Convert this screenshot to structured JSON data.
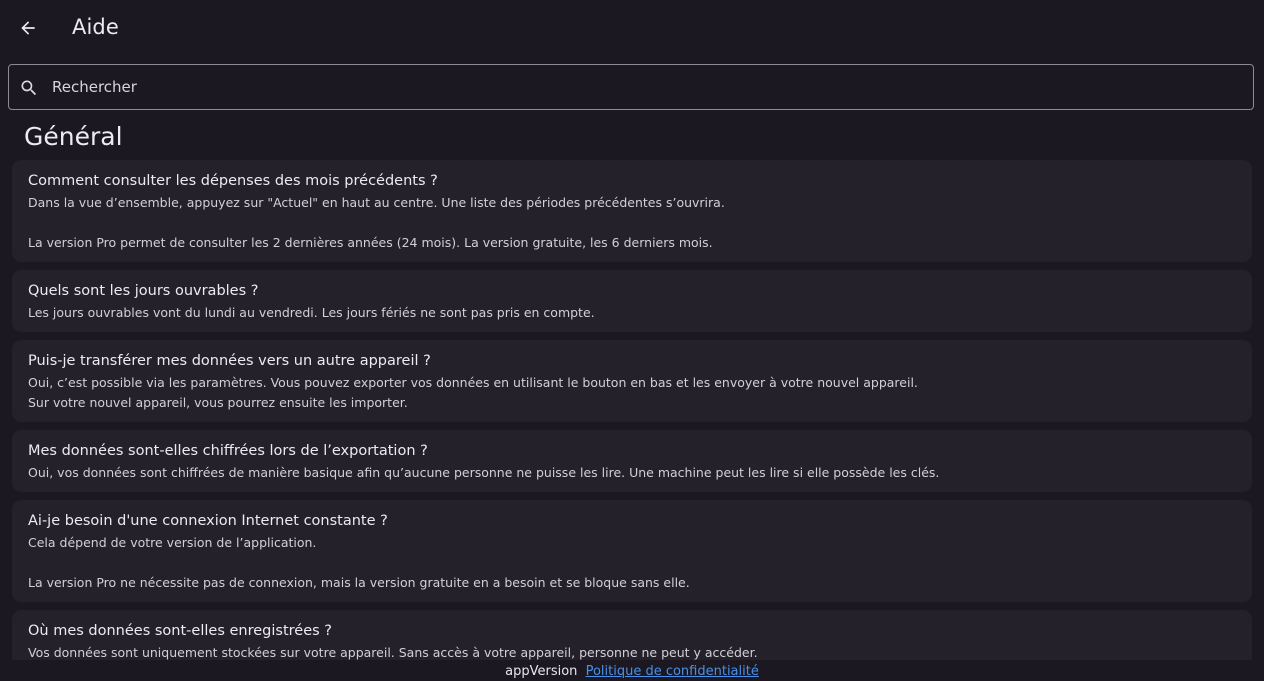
{
  "header": {
    "title": "Aide",
    "back_icon": "arrow-back-icon"
  },
  "search": {
    "placeholder": "Rechercher",
    "icon": "search-icon"
  },
  "section": {
    "title": "Général"
  },
  "faq": [
    {
      "question": "Comment consulter les dépenses des mois précédents ?",
      "answer": "Dans la vue d’ensemble, appuyez sur \"Actuel\" en haut au centre. Une liste des périodes précédentes s’ouvrira.\n\nLa version Pro permet de consulter les 2 dernières années (24 mois). La version gratuite, les 6 derniers mois."
    },
    {
      "question": "Quels sont les jours ouvrables ?",
      "answer": "Les jours ouvrables vont du lundi au vendredi. Les jours fériés ne sont pas pris en compte."
    },
    {
      "question": "Puis-je transférer mes données vers un autre appareil ?",
      "answer": "Oui, c’est possible via les paramètres. Vous pouvez exporter vos données en utilisant le bouton en bas et les envoyer à votre nouvel appareil.\nSur votre nouvel appareil, vous pourrez ensuite les importer."
    },
    {
      "question": "Mes données sont-elles chiffrées lors de l’exportation ?",
      "answer": "Oui, vos données sont chiffrées de manière basique afin qu’aucune personne ne puisse les lire. Une machine peut les lire si elle possède les clés."
    },
    {
      "question": "Ai-je besoin d'une connexion Internet constante ?",
      "answer": "Cela dépend de votre version de l’application.\n\nLa version Pro ne nécessite pas de connexion, mais la version gratuite en a besoin et se bloque sans elle."
    },
    {
      "question": "Où mes données sont-elles enregistrées ?",
      "answer": "Vos données sont uniquement stockées sur votre appareil. Sans accès à votre appareil, personne ne peut y accéder."
    }
  ],
  "footer": {
    "version": "appVersion",
    "privacy_link": "Politique de confidentialité"
  },
  "colors": {
    "background": "#1b1822",
    "card": "#24212b",
    "link": "#4a8fe8"
  }
}
